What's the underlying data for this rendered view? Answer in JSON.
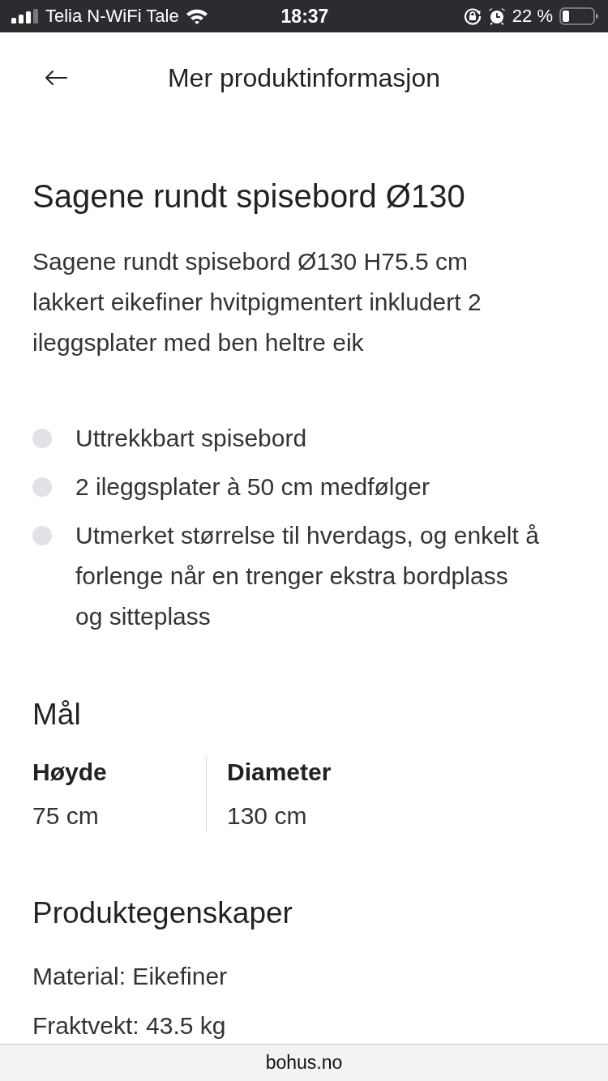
{
  "status_bar": {
    "carrier": "Telia N-WiFi Tale",
    "time": "18:37",
    "battery": "22 %"
  },
  "header": {
    "title": "Mer produktinformasjon"
  },
  "product": {
    "title": "Sagene rundt spisebord Ø130",
    "description": "Sagene rundt spisebord Ø130 H75.5 cm lakkert eikefiner hvitpigmentert inkludert 2 ileggsplater med ben heltre eik",
    "features": [
      "Uttrekkbart spisebord",
      "2 ileggsplater à 50 cm medfølger",
      "Utmerket størrelse til hverdags, og enkelt å forlenge når en trenger ekstra bordplass og sitteplass"
    ]
  },
  "dimensions": {
    "title": "Mål",
    "items": [
      {
        "label": "Høyde",
        "value": "75 cm"
      },
      {
        "label": "Diameter",
        "value": "130 cm"
      }
    ]
  },
  "properties": {
    "title": "Produktegenskaper",
    "items": [
      "Material: Eikefiner",
      "Fraktvekt: 43.5 kg"
    ]
  },
  "browser_bar": {
    "url": "bohus.no"
  }
}
